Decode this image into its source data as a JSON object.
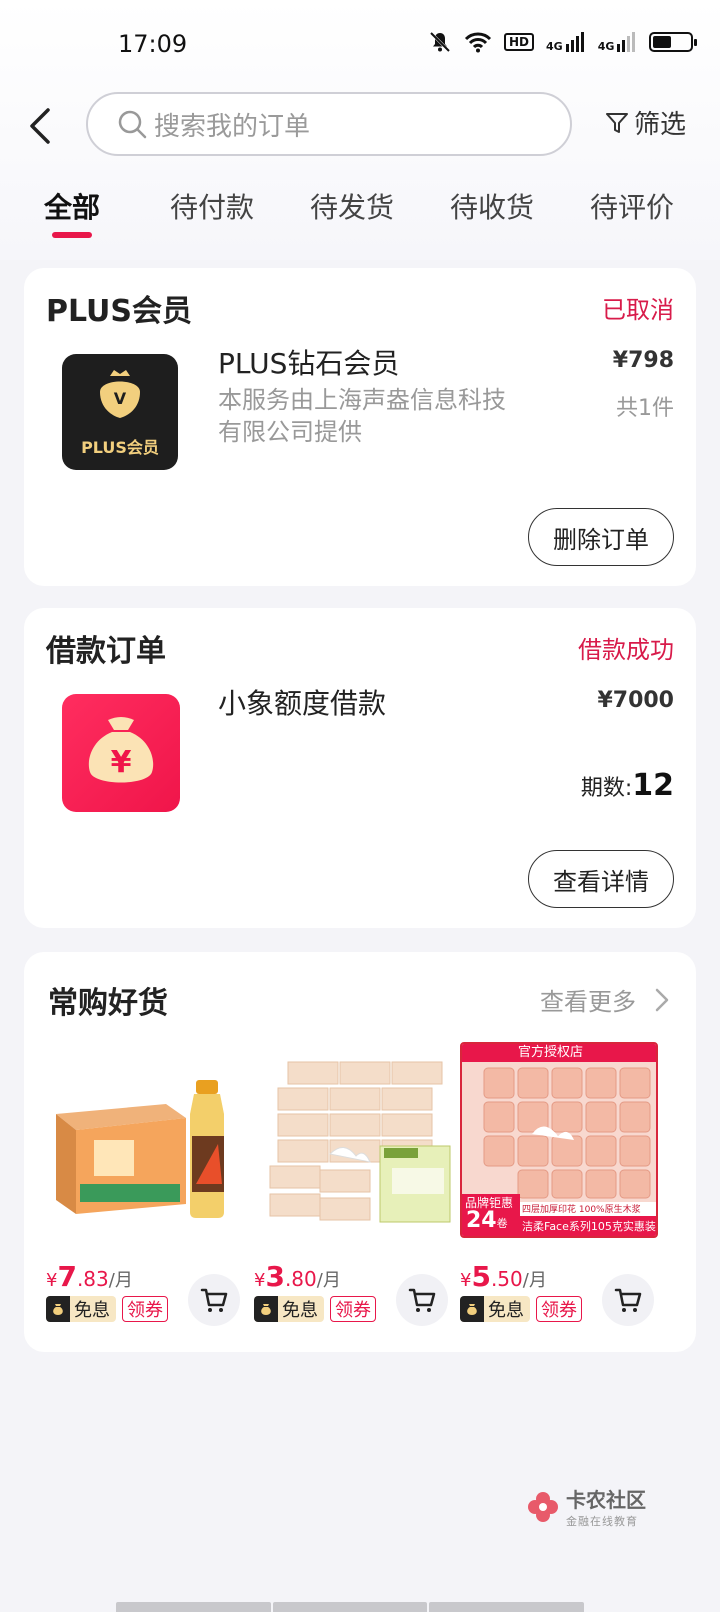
{
  "status_bar": {
    "time": "17:09",
    "hd_label": "HD",
    "net1": "4G",
    "net2": "4G"
  },
  "header": {
    "search_placeholder": "搜索我的订单",
    "filter_label": "筛选"
  },
  "tabs": [
    "全部",
    "待付款",
    "待发货",
    "待收货",
    "待评价"
  ],
  "active_tab_index": 0,
  "orders": [
    {
      "section_title": "PLUS会员",
      "status": "已取消",
      "thumb_label": "PLUS会员",
      "thumb_badge": "V",
      "product_name": "PLUS钻石会员",
      "description": [
        "本服务由上海声盎信息科技",
        "有限公司提供"
      ],
      "price": "¥798",
      "quantity": "共1件",
      "action": "删除订单"
    },
    {
      "section_title": "借款订单",
      "status": "借款成功",
      "thumb_symbol": "¥",
      "product_name": "小象额度借款",
      "price": "¥7000",
      "periods_label": "期数:",
      "periods_value": "12",
      "action": "查看详情"
    }
  ],
  "recommend": {
    "title": "常购好货",
    "more_label": "查看更多",
    "items": [
      {
        "currency": "¥",
        "price_int": "7",
        "price_dec": ".83",
        "unit": "/月",
        "tag_free": "免息",
        "tag_coupon": "领券"
      },
      {
        "currency": "¥",
        "price_int": "3",
        "price_dec": ".80",
        "unit": "/月",
        "tag_free": "免息",
        "tag_coupon": "领券"
      },
      {
        "currency": "¥",
        "price_int": "5",
        "price_dec": ".50",
        "unit": "/月",
        "tag_free": "免息",
        "tag_coupon": "领券"
      }
    ],
    "item3_banner": "官方授权店",
    "item3_brand_tag": "品牌钜惠",
    "item3_count": "24",
    "item3_count_unit": "卷",
    "item3_caption": "洁柔Face系列105克实惠装",
    "item3_subcaption": "四层加厚印花 100%原生木浆"
  },
  "watermark": {
    "main": "卡农社区",
    "sub": "金融在线教育"
  },
  "colors": {
    "accent": "#e8174a",
    "background": "#f4f4f8"
  }
}
